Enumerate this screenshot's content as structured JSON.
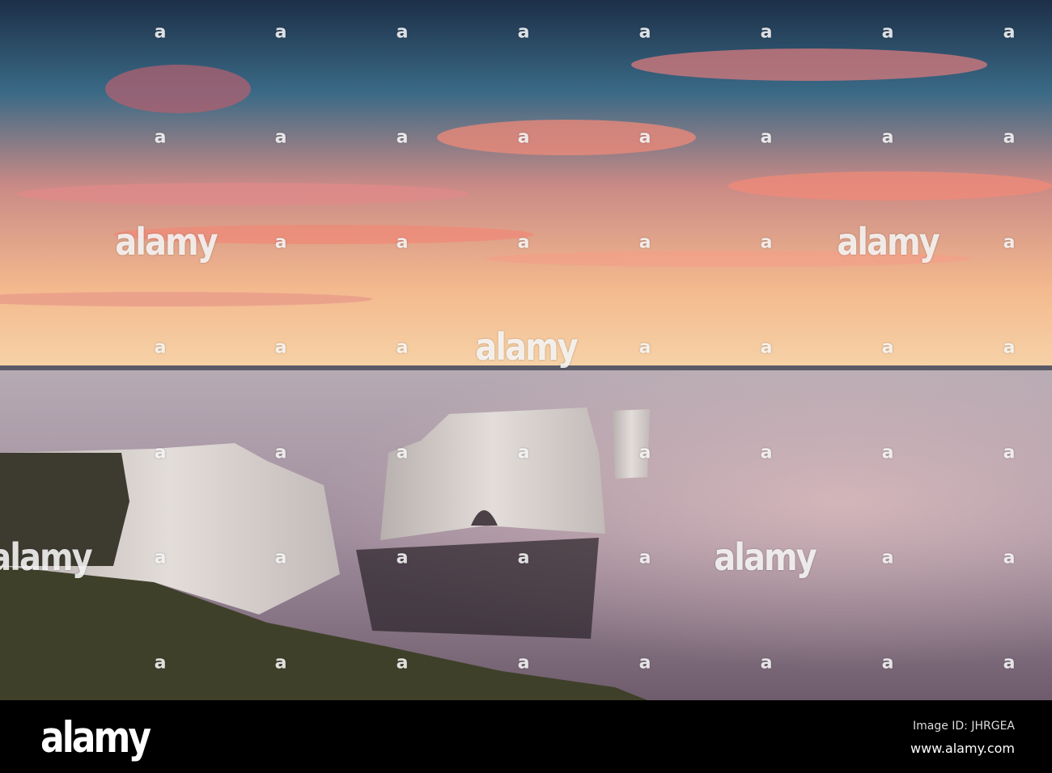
{
  "watermark": {
    "brand": "alamy",
    "mark": "a"
  },
  "footer": {
    "logo": "alamy",
    "image_id": "Image ID: JHRGEA",
    "url": "www.alamy.com"
  },
  "colors": {
    "sky_top": "#1f3a55",
    "sky_glow": "#f6c98a",
    "sea": "#a89aa6",
    "chalk": "#dcd6d2"
  }
}
